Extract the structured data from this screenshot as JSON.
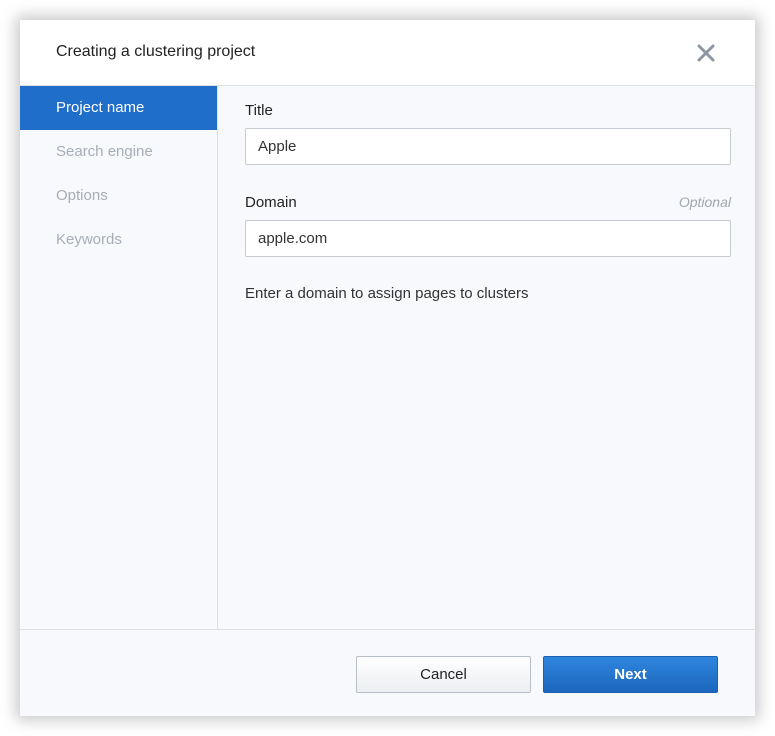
{
  "dialog": {
    "title": "Creating a clustering project",
    "close_icon": "close-icon"
  },
  "sidebar": {
    "steps": [
      {
        "label": "Project name",
        "active": true
      },
      {
        "label": "Search engine",
        "active": false
      },
      {
        "label": "Options",
        "active": false
      },
      {
        "label": "Keywords",
        "active": false
      }
    ]
  },
  "form": {
    "title_label": "Title",
    "title_value": "Apple",
    "domain_label": "Domain",
    "domain_optional": "Optional",
    "domain_value": "apple.com",
    "hint": "Enter a domain to assign pages to clusters"
  },
  "footer": {
    "cancel_label": "Cancel",
    "next_label": "Next"
  },
  "colors": {
    "accent": "#1f6ec9",
    "panel_bg": "#f8f9fc",
    "muted_text": "#a7adb7"
  }
}
